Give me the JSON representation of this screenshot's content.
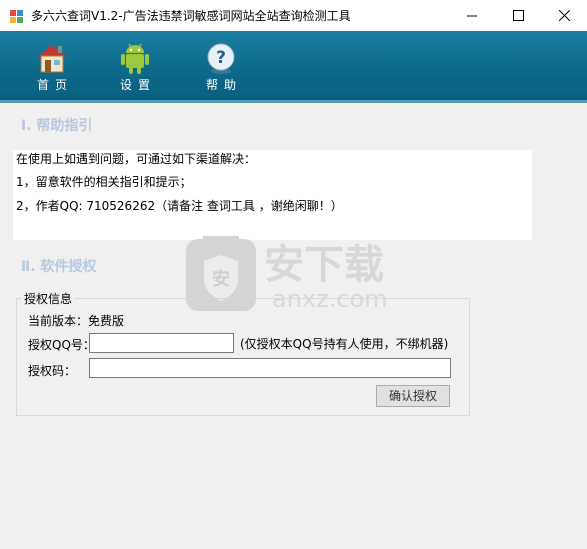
{
  "window": {
    "title": "多六六查词V1.2-广告法违禁词敏感词网站全站查询检测工具"
  },
  "toolbar": {
    "items": [
      {
        "label": "首页",
        "icon": "home-icon"
      },
      {
        "label": "设置",
        "icon": "android-icon"
      },
      {
        "label": "帮助",
        "icon": "help-icon"
      }
    ]
  },
  "help": {
    "heading": "Ⅰ. 帮助指引",
    "lines": [
      "在使用上如遇到问题，可通过如下渠道解决：",
      "1，留意软件的相关指引和提示；",
      "2，作者QQ: 710526262（请备注 查词工具 ，谢绝闲聊！）"
    ]
  },
  "license": {
    "heading": "Ⅱ. 软件授权",
    "group_title": "授权信息",
    "version_label": "当前版本：",
    "version_value": "免费版",
    "qq_label": "授权QQ号：",
    "qq_value": "",
    "qq_hint": "(仅授权本QQ号持有人使用，不绑机器)",
    "code_label": "授权码：",
    "code_value": "",
    "confirm_button": "确认授权"
  },
  "watermark": {
    "text_cn": "安下载",
    "text_en": "anxz.com",
    "badge": "安"
  }
}
